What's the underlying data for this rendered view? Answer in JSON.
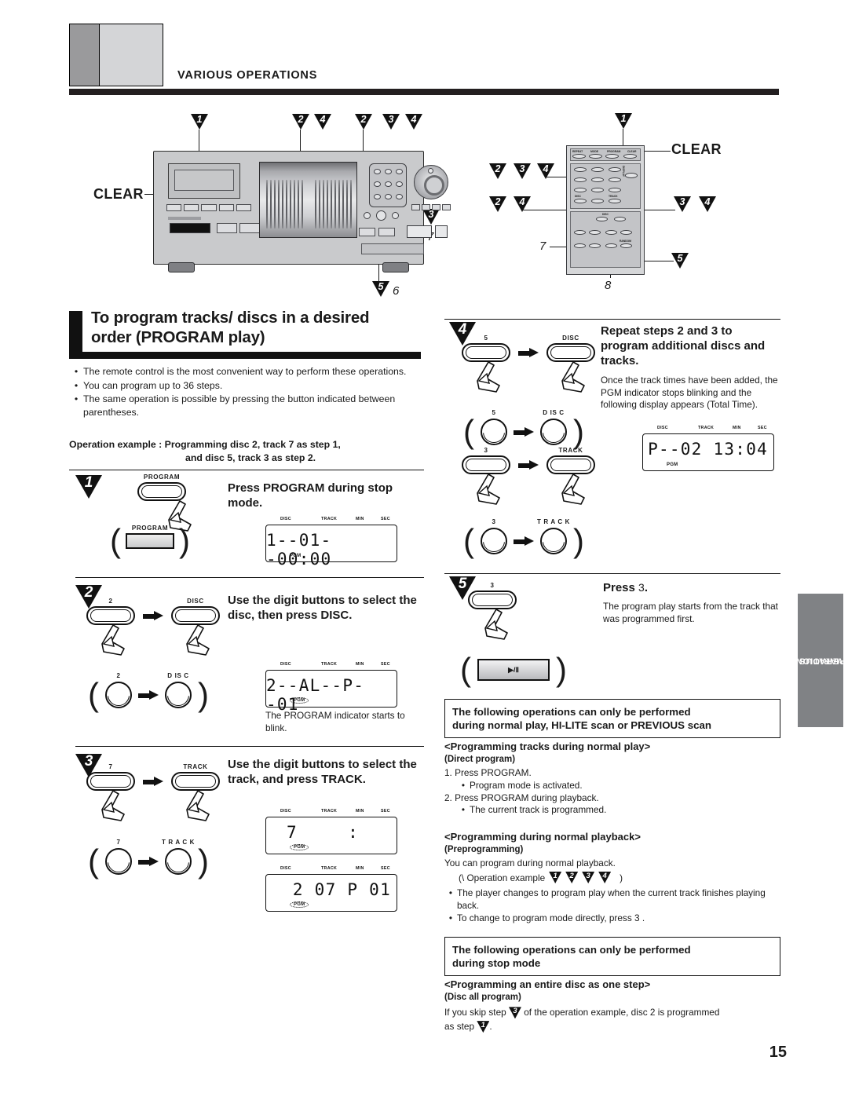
{
  "header": {
    "section_title": "VARIOUS OPERATIONS"
  },
  "illustration": {
    "clear_label_left": "CLEAR",
    "clear_label_right": "CLEAR",
    "deck_callouts": [
      "1",
      "2",
      "4",
      "2",
      "3",
      "4",
      "3",
      "7",
      "5",
      "6"
    ],
    "remote_callouts": [
      "1",
      "2",
      "3",
      "4",
      "2",
      "4",
      "3",
      "4",
      "7",
      "8",
      "5"
    ],
    "remote_buttons": {
      "top_row": [
        "REPEAT",
        "MODE",
        "PROGRAM",
        "CLEAR"
      ],
      "digits": [
        "1",
        "2",
        "3",
        "4",
        "5",
        "6",
        "7",
        "8",
        "9",
        "0"
      ],
      "display": "DISPLAY",
      "disc": "DISC",
      "track": "TRACK",
      "disc_pm": "DISC",
      "random": "RANDOM"
    }
  },
  "section": {
    "title_line1": "To program tracks/ discs in a desired",
    "title_line2": "order (PROGRAM play)",
    "bullets": [
      "The remote control is the most convenient way to perform these operations.",
      "You can program up to 36 steps.",
      "The same operation is possible by pressing the button indicated between parentheses."
    ],
    "operation_example_label": "Operation example :",
    "operation_example_line1": "Programming disc 2, track 7 as step 1,",
    "operation_example_line2": "and disc 5, track 3 as step 2."
  },
  "steps": [
    {
      "num": "1",
      "instruction": "Press PROGRAM during stop mode.",
      "button_label": "PROGRAM",
      "paren_label": "PROGRAM",
      "display": {
        "headers": [
          "DISC",
          "TRACK",
          "MIN",
          "SEC"
        ],
        "value": "1--01--00:00",
        "pgm": "PGM",
        "pgm_blink": false
      }
    },
    {
      "num": "2",
      "instruction": "Use the digit buttons to select the disc, then press DISC.",
      "button_label_1": "2",
      "button_label_2": "DISC",
      "paren_label_1": "2",
      "paren_label_2": "D IS C",
      "display": {
        "headers": [
          "DISC",
          "TRACK",
          "MIN",
          "SEC"
        ],
        "value": "2--AL--P--01",
        "pgm": "PGM",
        "pgm_blink": true
      },
      "caption": "The PROGRAM indicator starts to blink."
    },
    {
      "num": "3",
      "instruction": "Use the digit buttons to select the track, and press TRACK.",
      "button_label_1": "7",
      "button_label_2": "TRACK",
      "paren_label_1": "7",
      "paren_label_2": "T R A C K",
      "display_1": {
        "headers": [
          "DISC",
          "TRACK",
          "MIN",
          "SEC"
        ],
        "value": "7",
        "value_right": ":",
        "pgm": "PGM",
        "pgm_blink": true
      },
      "display_2": {
        "headers": [
          "DISC",
          "TRACK",
          "MIN",
          "SEC"
        ],
        "value": "2  07  P  01",
        "pgm": "PGM",
        "pgm_blink": true
      }
    },
    {
      "num": "4",
      "instruction": "Repeat steps 2 and 3 to program additional discs and tracks.",
      "sub": "Once the track times have been added, the PGM indicator stops blinking and the following display appears (Total Time).",
      "button_label_1": "5",
      "button_label_2": "DISC",
      "button_label_3": "3",
      "button_label_4": "TRACK",
      "paren_label_1": "5",
      "paren_label_2": "D IS C",
      "paren_label_3": "3",
      "paren_label_4": "T R A C K",
      "display": {
        "headers": [
          "DISC",
          "TRACK",
          "MIN",
          "SEC"
        ],
        "value": "P--02   13:04",
        "pgm": "PGM",
        "pgm_blink": false
      }
    },
    {
      "num": "5",
      "instruction_pre": "Press",
      "instruction_sym": "3",
      "instruction_post": ".",
      "sub": "The program play starts from the track that was programmed first.",
      "button_label_1": "3",
      "paren_label": "▶/Ⅱ"
    }
  ],
  "right_column": {
    "box1_line1": "The following operations can only be performed",
    "box1_line2": "during normal play, HI-LITE scan or PREVIOUS scan",
    "sub1_title": "<Programming tracks during normal play>",
    "sub1_paren": "(Direct program)",
    "sub1_items": [
      "1. Press PROGRAM.",
      "Program mode is activated.",
      "2. Press PROGRAM during playback.",
      "The current track is programmed."
    ],
    "sub2_title": "<Programming during normal playback>",
    "sub2_paren": "(Preprogramming)",
    "sub2_lead": "You can program during normal playback.",
    "sub2_example_label": "(\\  Operation example",
    "sub2_example_marks": [
      "1",
      "2",
      "3",
      "4"
    ],
    "sub2_example_close": ")",
    "sub2_bullets": [
      "The player changes to program play when the current track finishes playing back.",
      "To change to program mode directly, press 3 ."
    ],
    "box2_line1": "The following operations can only be performed",
    "box2_line2": "during stop mode",
    "sub3_title": "<Programming an entire disc as one step>",
    "sub3_paren": "(Disc all program)",
    "sub3_text_a": "If you skip step",
    "sub3_mark_a": "3",
    "sub3_text_b": "of the operation example, disc 2 is programmed",
    "sub3_text_c": "as step",
    "sub3_mark_b": "1",
    "sub3_text_d": "."
  },
  "side_tab": {
    "line1": "VARIOUS",
    "line2": "OPERATIONS"
  },
  "footer": {
    "page_number": "15"
  }
}
